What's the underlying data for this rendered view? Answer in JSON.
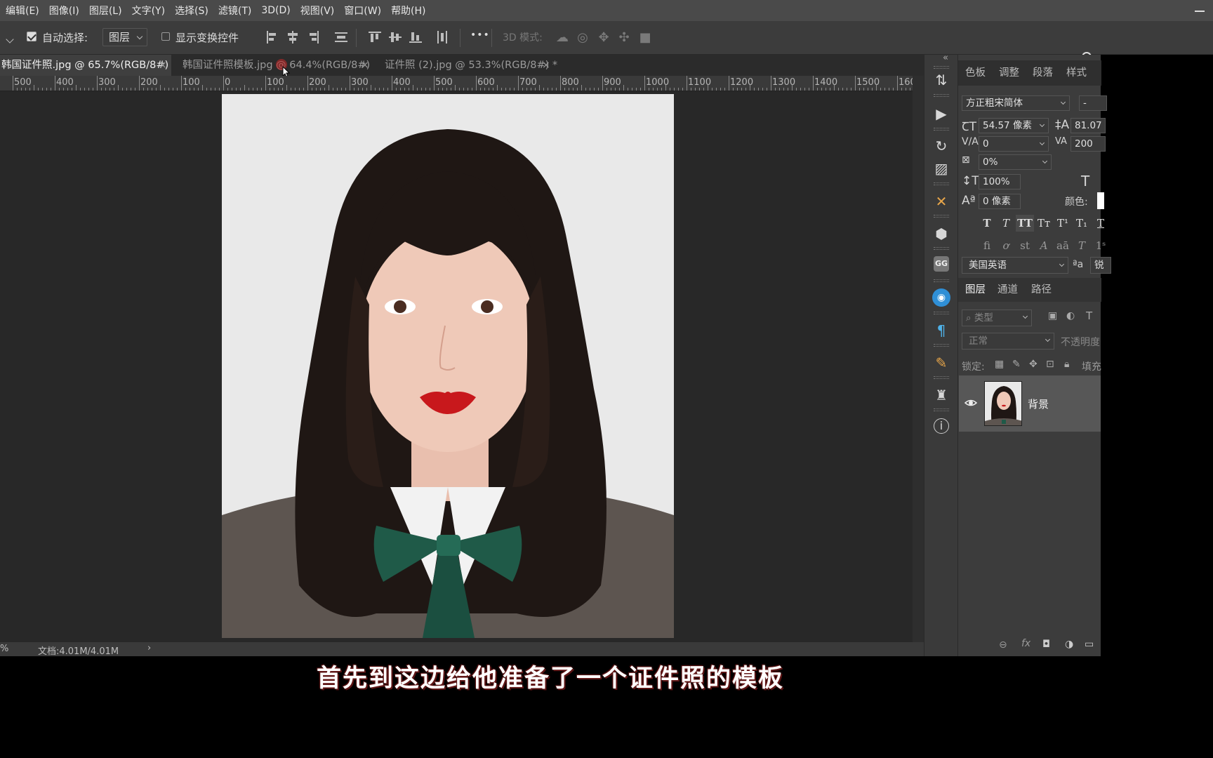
{
  "menu": [
    "编辑(E)",
    "图像(I)",
    "图层(L)",
    "文字(Y)",
    "选择(S)",
    "滤镜(T)",
    "3D(D)",
    "视图(V)",
    "窗口(W)",
    "帮助(H)"
  ],
  "options": {
    "auto_select_label": "自动选择:",
    "auto_select_checked": true,
    "auto_select_target": "图层",
    "show_transform_label": "显示变换控件",
    "show_transform_checked": false,
    "more": "•••",
    "mode3d_label": "3D 模式:"
  },
  "tabs": [
    {
      "label": "韩国证件照.jpg @ 65.7%(RGB/8#)",
      "active": true
    },
    {
      "label": "韩国证件照模板.jpg @ 64.4%(RGB/8#)",
      "active": false
    },
    {
      "label": "证件照 (2).jpg @ 53.3%(RGB/8#) *",
      "active": false
    }
  ],
  "ruler": {
    "labels": [
      "500",
      "400",
      "300",
      "200",
      "100",
      "0",
      "100",
      "200",
      "300",
      "400",
      "500",
      "600",
      "700",
      "800",
      "900",
      "1000",
      "1100",
      "1200",
      "1300",
      "1400",
      "1500",
      "160("
    ]
  },
  "status": {
    "zoom_tail": "%",
    "doc_info": "文档:4.01M/4.01M",
    "arrow": "›"
  },
  "subtitle": "首先到这边给他准备了一个证件照的模板",
  "panel_top": {
    "tabs": [
      "色板",
      "调整",
      "段落",
      "样式"
    ],
    "collapse": "«",
    "font_family": "方正粗宋简体",
    "font_style": "-",
    "font_size": "54.57 像素",
    "leading": "81.07",
    "kerning": "0",
    "tracking": "200",
    "scale_pct": "0%",
    "vscale": "100%",
    "baseline": "0 像素",
    "color_label": "颜色:",
    "type_buttons": [
      "T",
      "T",
      "TT",
      "Tт",
      "T¹",
      "T₁",
      "T"
    ],
    "ot_buttons": [
      "fi",
      "ơ",
      "st",
      "A",
      "aā",
      "T",
      "1ˢ"
    ],
    "language": "美国英语",
    "aa_icon": "ªa",
    "aa_value": "锐"
  },
  "layers_panel": {
    "tabs": [
      "图层",
      "通道",
      "路径"
    ],
    "filter_placeholder": "类型",
    "blend_mode": "正常",
    "opacity_label": "不透明度",
    "lock_label": "锁定:",
    "fill_label": "填充",
    "layers": [
      {
        "name": "背景",
        "visible": true
      }
    ]
  },
  "icons": {
    "tools": [
      "history-icon",
      "play-icon",
      "rotate-icon",
      "image-icon",
      "crossed-tools-icon",
      "3d-cube-icon",
      "gg-icon",
      "color-wheel-icon",
      "paragraph-icon",
      "brush-icon",
      "clone-stamp-icon",
      "info-icon"
    ]
  },
  "colors": {
    "app_bg": "#282828",
    "panel_bg": "#3c3c3c",
    "subtitle_shadow": "#5a1414",
    "lip_red": "#c8181c",
    "bow_green": "#1f5a48"
  }
}
